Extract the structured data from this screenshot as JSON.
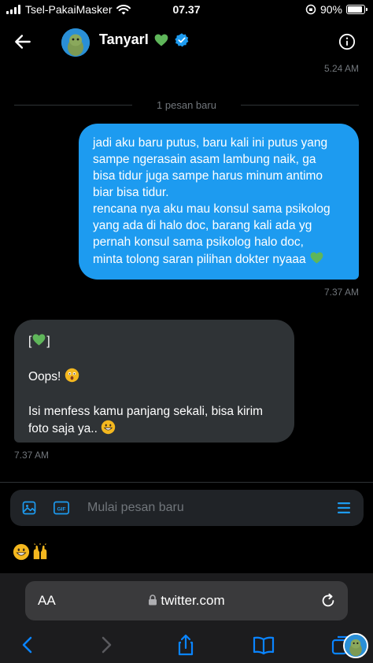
{
  "status_bar": {
    "carrier": "Tsel-PakaiMasker",
    "time": "07.37",
    "battery": "90%",
    "battery_level": 0.9
  },
  "header": {
    "title": "TanyarI",
    "heart_color": "#5fb65a",
    "verified_color": "#1d9bf0",
    "icons": [
      "back-arrow-icon",
      "verified-badge-icon",
      "info-icon"
    ]
  },
  "chat": {
    "prev_timestamp": "5.24 AM",
    "new_messages_label": "1 pesan baru",
    "sent": {
      "lines": [
        "jadi aku baru putus, baru kali ini putus yang",
        "sampe ngerasain asam lambung naik, ga",
        "bisa tidur juga sampe harus minum antimo",
        "biar bisa tidur.",
        "rencana nya aku mau konsul sama psikolog",
        "yang ada di halo doc, barang kali ada yg",
        "pernah konsul sama psikolog halo doc,",
        "minta tolong saran pilihan dokter nyaaa"
      ],
      "timestamp": "7.37 AM"
    },
    "received": {
      "line1_open": "[",
      "line1_close": "]",
      "line2": "Oops!",
      "line3": "Isi menfess kamu panjang sekali, bisa kirim",
      "line4": "foto saja ya..",
      "timestamp": "7.37 AM"
    }
  },
  "composer": {
    "placeholder": "Mulai pesan baru",
    "accent": "#1d9bf0"
  },
  "reactions": [
    "😃",
    "🙌"
  ],
  "browser": {
    "aa_label": "AA",
    "url": "twitter.com"
  }
}
